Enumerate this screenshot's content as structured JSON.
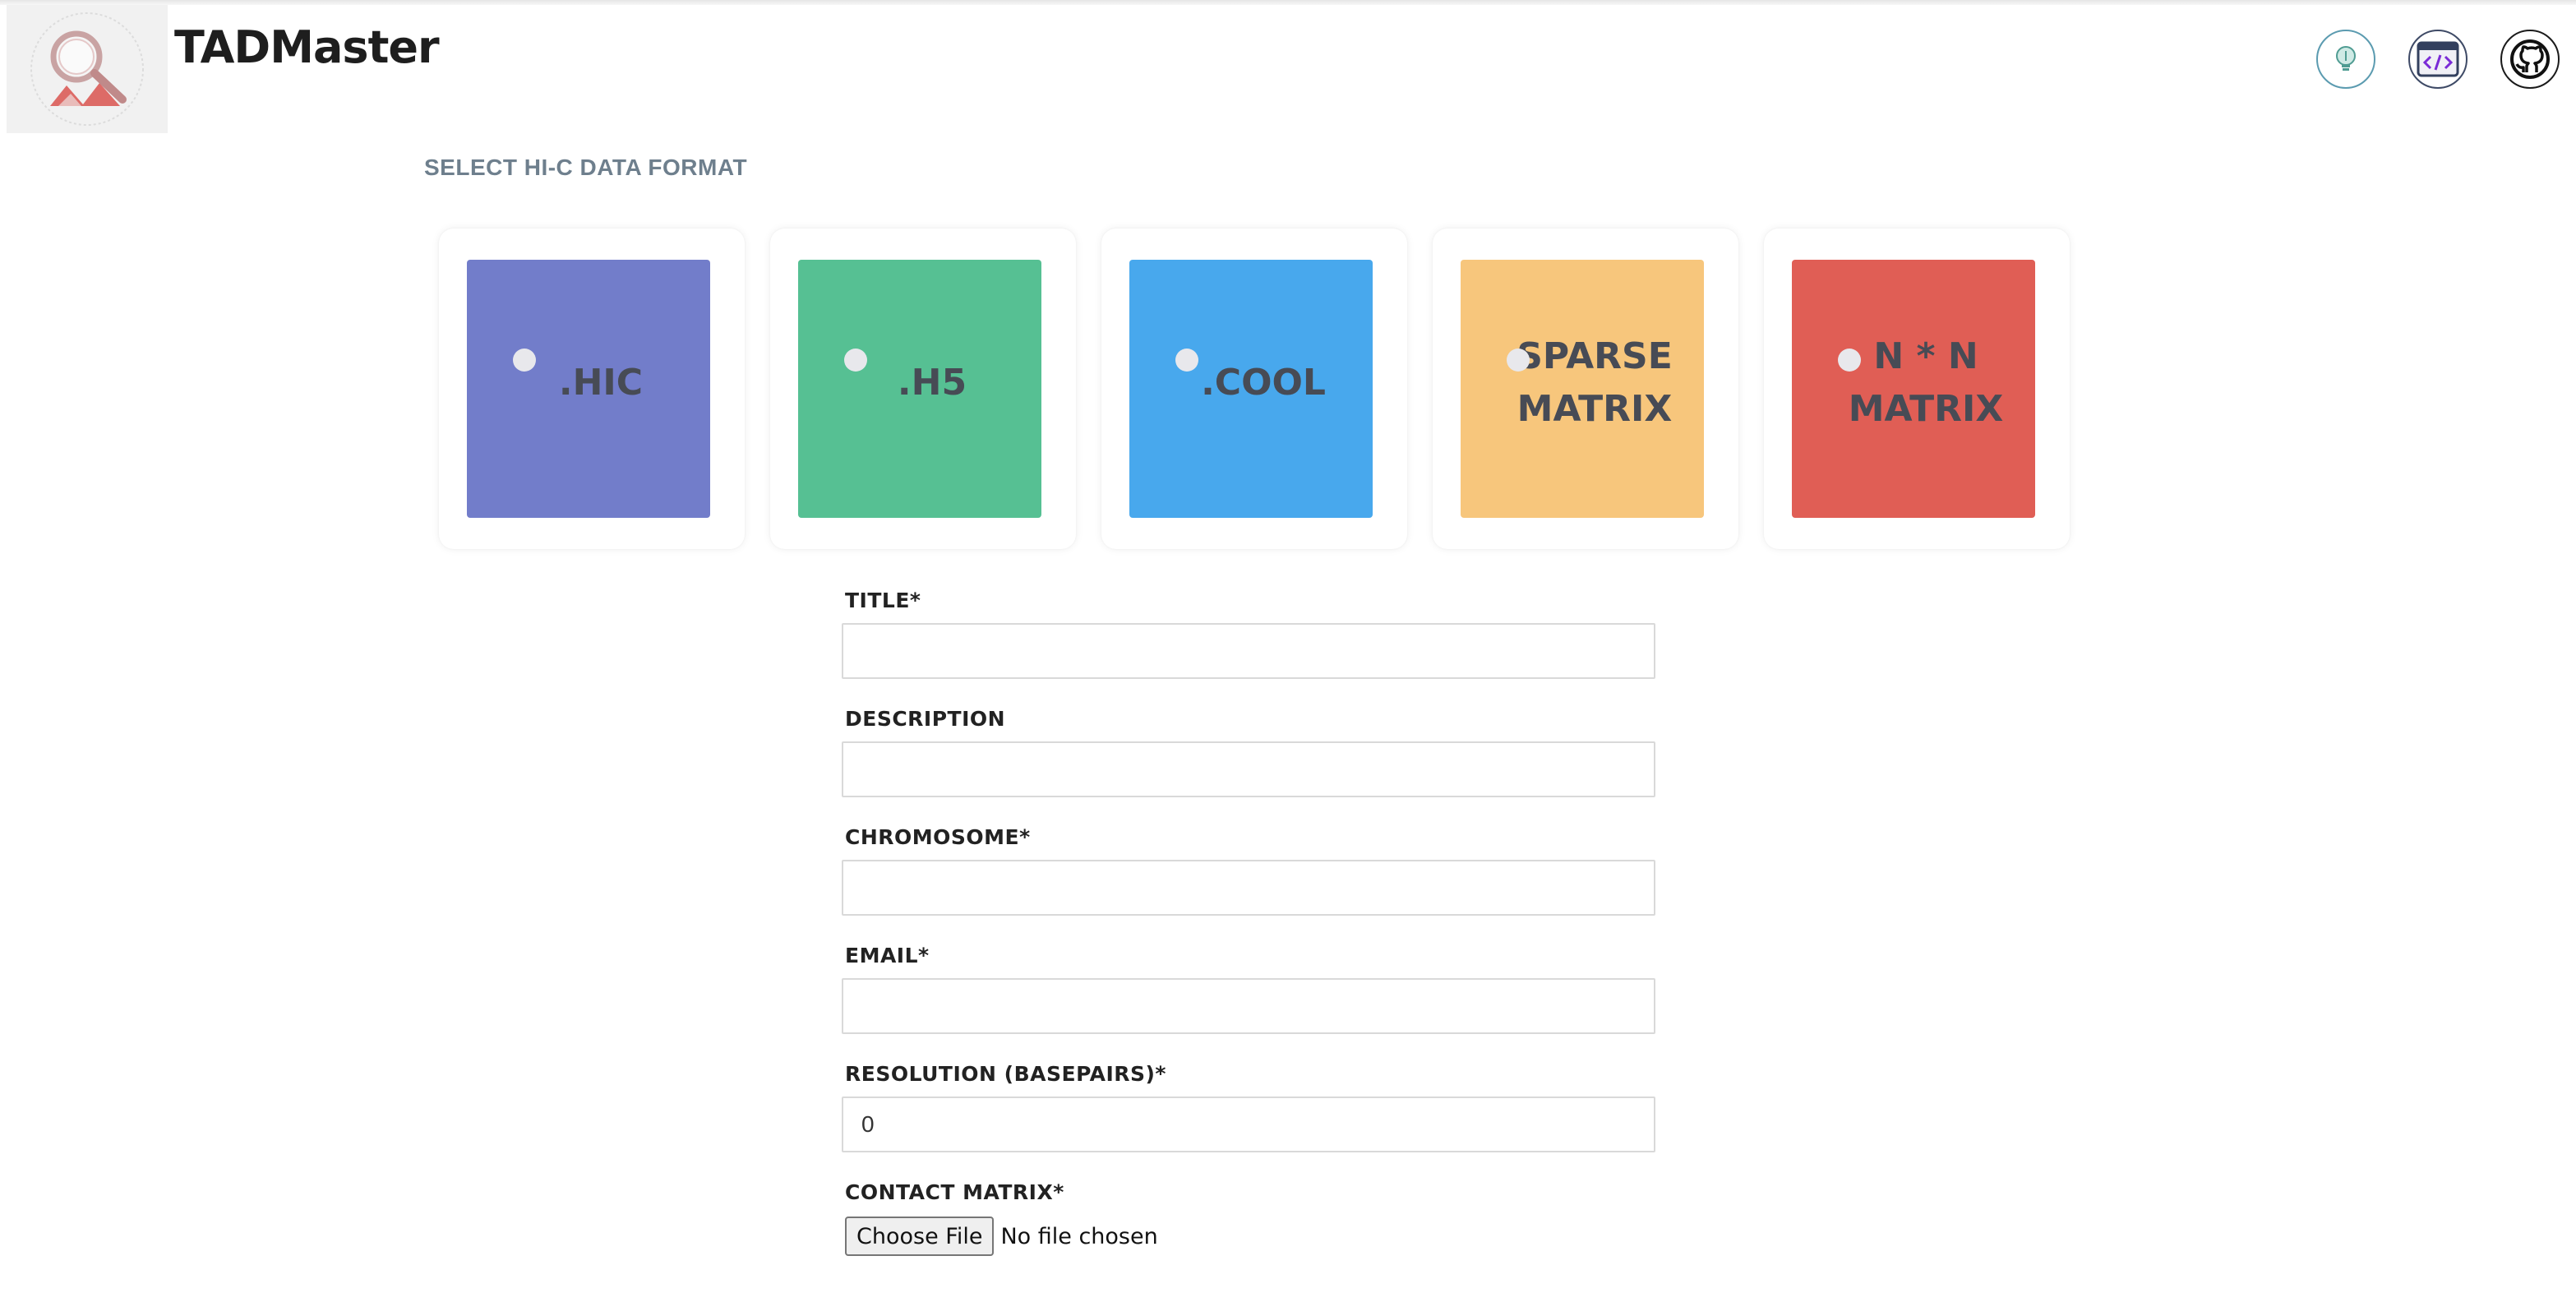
{
  "app": {
    "name": "TADMaster"
  },
  "header": {
    "icons": [
      {
        "name": "lightbulb-icon"
      },
      {
        "name": "code-icon"
      },
      {
        "name": "github-icon"
      }
    ]
  },
  "format_section": {
    "title": "SELECT HI-C DATA FORMAT",
    "options": [
      {
        "label": ".HIC",
        "color": "#727dca"
      },
      {
        "label": ".H5",
        "color": "#56c093"
      },
      {
        "label": ".COOL",
        "color": "#48a8ed"
      },
      {
        "label": "SPARSE\nMATRIX",
        "color": "#f7c67c"
      },
      {
        "label": "N * N\nMATRIX",
        "color": "#e05e55"
      }
    ]
  },
  "form": {
    "title_label": "TITLE*",
    "title_value": "",
    "description_label": "DESCRIPTION",
    "description_value": "",
    "chromosome_label": "CHROMOSOME*",
    "chromosome_value": "",
    "email_label": "EMAIL*",
    "email_value": "",
    "resolution_label": "RESOLUTION (BASEPAIRS)*",
    "resolution_value": "0",
    "contact_matrix_label": "CONTACT MATRIX*",
    "file_button_label": "Choose File",
    "file_status": "No file chosen"
  }
}
